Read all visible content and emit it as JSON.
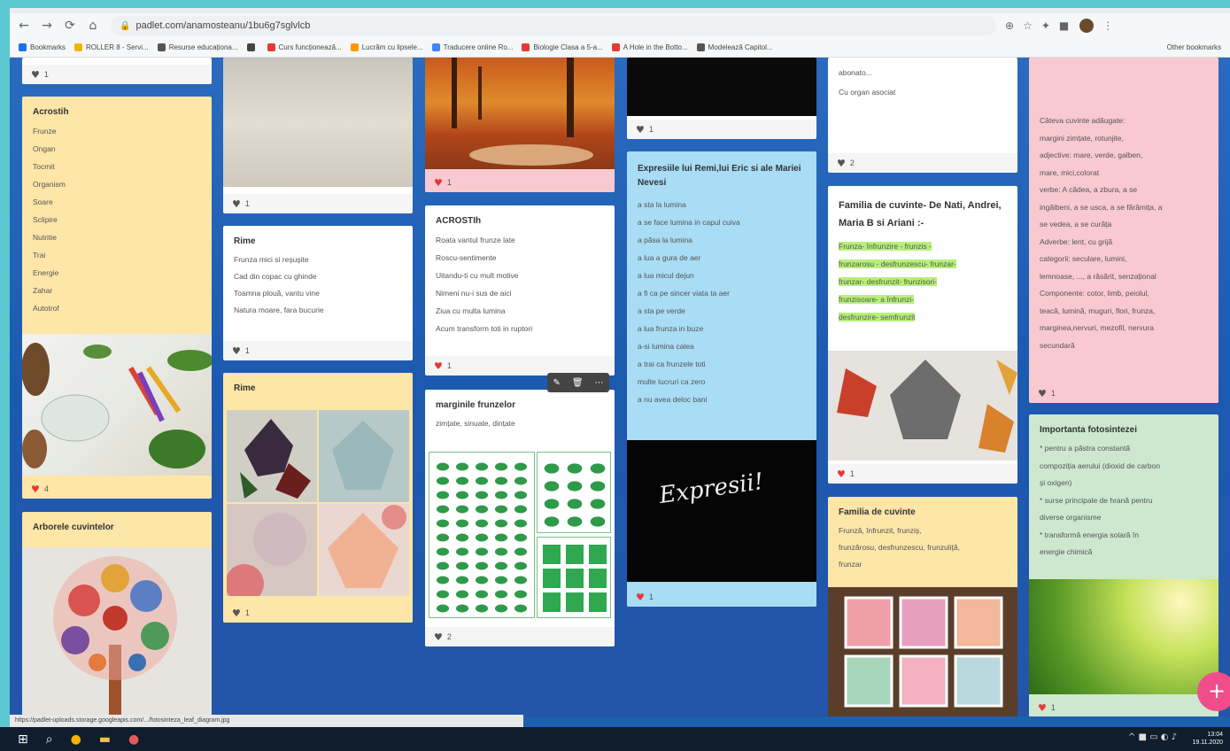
{
  "browser": {
    "url": "padlet.com/anamosteanu/1bu6g7sglvlcb",
    "profile_color": "#6b4a2b"
  },
  "bookmarks": [
    {
      "label": "Bookmarks",
      "color": "#1a73e8"
    },
    {
      "label": "ROLLER 8 - Servi...",
      "color": "#f4b400"
    },
    {
      "label": "Resurse educaționa...",
      "color": "#555"
    },
    {
      "label": "",
      "color": "#444"
    },
    {
      "label": "Curs funcționează...",
      "color": "#e53935"
    },
    {
      "label": "Lucrăm cu lipsele...",
      "color": "#ff9800"
    },
    {
      "label": "Traducere online Ro...",
      "color": "#4285f4"
    },
    {
      "label": "Biologie Clasa a 5-a...",
      "color": "#e53935"
    },
    {
      "label": "A Hole in the Botto...",
      "color": "#e53935"
    },
    {
      "label": "Modelează Capitol...",
      "color": "#555"
    }
  ],
  "bookmarks_other": "Other bookmarks",
  "cards": {
    "c1_top_likes": "1",
    "acrostih": {
      "title": "Acrostih",
      "lines": [
        "Frunze",
        "Ongan",
        "Tocmit",
        "Organism",
        "Soare",
        "Sclipire",
        "Nutritie",
        "Trai",
        "Energie",
        "Zahar",
        "Autotrof"
      ],
      "likes": "4"
    },
    "arborele": {
      "title": "Arborele cuvintelor"
    },
    "col2_top_likes": "1",
    "rime1": {
      "title": "Rime",
      "lines": [
        "Frunza mici si reșușite",
        "Cad din copac cu ghinde",
        "Toamna plouă, vantu vine",
        "Natura moare, fara bucurie"
      ],
      "likes": "1"
    },
    "rime2": {
      "title": "Rime",
      "likes": "1"
    },
    "col3_top_likes": "1",
    "acrostih2": {
      "title": "ACROSTIh",
      "lines": [
        "Roata vantul frunze late",
        "Roscu-sentimente",
        "Uitandu-ti cu mult motive",
        "Nimeni nu-i sus de aici",
        "Ziua cu multa lumina",
        "Acum transform toti in ruptori"
      ],
      "likes": "1"
    },
    "marginile": {
      "title": "marginile frunzelor",
      "subtitle": "zimțate, sinuate, dințate",
      "likes": "2"
    },
    "col4_top_likes": "1",
    "expresii": {
      "title": "Expresiile lui Remi,lui Eric si ale Mariei Nevesi",
      "lines": [
        "a sta la lumina",
        "a se face lumina in capul cuiva",
        "a pãsa la lumina",
        "a lua a gura de aer",
        "a lua micul dejun",
        "a fi ca pe sincer viata ta aer",
        "a sta pe verde",
        "a lua frunza in buze",
        "a-si lumina calea",
        "a trai ca frunzele toti",
        "multe lucruri ca zero",
        "a nu avea deloc bani"
      ],
      "handwriting": "Expresii!",
      "likes": "1"
    },
    "col5_top": {
      "lines": [
        "abonato...",
        "Cu organ asociat"
      ],
      "likes": "2"
    },
    "familia1": {
      "title": "Familia de cuvinte- De Nati, Andrei, Maria B si Ariani :-",
      "lines": [
        "Frunza- înfrunzire - frunzis -",
        "frunzarosu - desfrunzescu- frunzar-",
        "frunzar- desfrunzit- frunzisori-",
        "frunzisoare- a înfrunzi-",
        "desfrunzire- semfrunzit"
      ],
      "likes": "1"
    },
    "familia2": {
      "title": "Familia de cuvinte",
      "lines": [
        "Frunză, înfrunzit, frunziș,",
        "frunzărosu, desfrunzescu, frunzuliță,",
        "frunzar"
      ]
    },
    "col6_pink": {
      "lines": [
        "Câteva cuvinte adăugate:",
        "margini zimțate, rotunjite,",
        "adjective: mare, verde, galben,",
        "mare, mici,colorat",
        "verbe: A cădea, a zbura, a se",
        "ingălbeni, a se usca, a se fărâmița, a",
        "se vedea, a se curăța",
        "Adverbe: lent, cu grijă",
        "categorii: seculare, lumini,",
        "lemnoase, ..., a răsărit, senzațional",
        "Componente: cotor, limb, peiolul,",
        "teacă, lumină, muguri, flori, frunza,",
        "marginea,nervuri, mezofil, nervura",
        "secundară"
      ],
      "likes": "1"
    },
    "importanta": {
      "title": "Importanta fotosintezei",
      "lines": [
        "* pentru a păstra constantă",
        "compoziția aerului (dioxid de carbon",
        "și oxigen)",
        "* surse principale de hrană pentru",
        "diverse organisme",
        "* transformă energia solară în",
        "energie chimică"
      ],
      "likes": "1"
    }
  },
  "statusbar": "https://padlet-uploads.storage.googleapis.com/.../fotosinteza_leaf_diagram.jpg",
  "fab_icon": "+",
  "taskbar": {
    "time": "13:04",
    "date": "19.11.2020"
  }
}
